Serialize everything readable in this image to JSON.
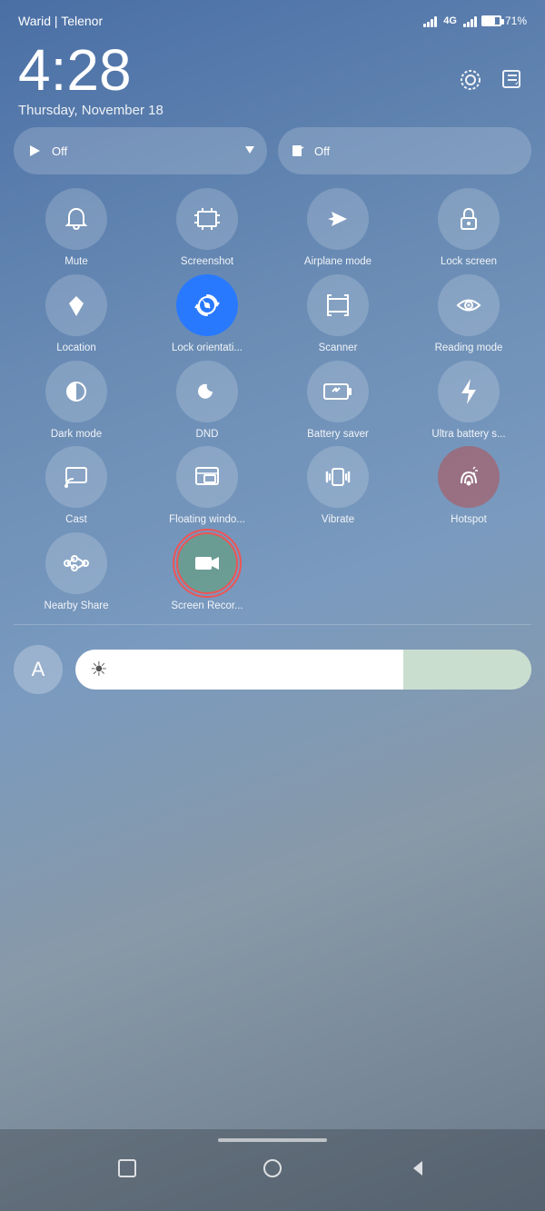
{
  "statusBar": {
    "carrier": "Warid | Telenor",
    "networkType": "4G",
    "batteryPercent": "71%"
  },
  "clock": {
    "time": "4:28",
    "date": "Thursday, November 18"
  },
  "quickPills": [
    {
      "id": "pill-left",
      "icon": "▶",
      "label": "Off"
    },
    {
      "id": "pill-right",
      "icon": "🎵",
      "label": "Off"
    }
  ],
  "quickItems": [
    {
      "id": "mute",
      "label": "Mute",
      "icon": "bell",
      "active": false
    },
    {
      "id": "screenshot",
      "label": "Screenshot",
      "icon": "screenshot",
      "active": false
    },
    {
      "id": "airplane",
      "label": "Airplane mode",
      "icon": "airplane",
      "active": false
    },
    {
      "id": "lockscreen",
      "label": "Lock screen",
      "icon": "lock",
      "active": false
    },
    {
      "id": "location",
      "label": "Location",
      "icon": "location",
      "active": false
    },
    {
      "id": "lock-orientation",
      "label": "Lock orientati...",
      "icon": "rotate",
      "active": true
    },
    {
      "id": "scanner",
      "label": "Scanner",
      "icon": "scanner",
      "active": false
    },
    {
      "id": "reading-mode",
      "label": "Reading mode",
      "icon": "eye",
      "active": false
    },
    {
      "id": "dark-mode",
      "label": "Dark mode",
      "icon": "darkmode",
      "active": false
    },
    {
      "id": "dnd",
      "label": "DND",
      "icon": "moon",
      "active": false
    },
    {
      "id": "battery-saver",
      "label": "Battery saver",
      "icon": "battery-saver",
      "active": false
    },
    {
      "id": "ultra-battery",
      "label": "Ultra battery s...",
      "icon": "lightning",
      "active": false
    },
    {
      "id": "cast",
      "label": "Cast",
      "icon": "cast",
      "active": false
    },
    {
      "id": "floating-window",
      "label": "Floating windo...",
      "icon": "floating",
      "active": false
    },
    {
      "id": "vibrate",
      "label": "Vibrate",
      "icon": "vibrate",
      "active": false
    },
    {
      "id": "hotspot",
      "label": "Hotspot",
      "icon": "hotspot",
      "active": false,
      "special": "red"
    },
    {
      "id": "nearby-share",
      "label": "Nearby Share",
      "icon": "nearby",
      "active": false
    },
    {
      "id": "screen-record",
      "label": "Screen Recor...",
      "icon": "video",
      "active": false,
      "special": "selected"
    }
  ],
  "bottomControls": {
    "avatarLabel": "A",
    "brightnessLabel": "brightness"
  },
  "nav": {
    "homeBarColor": "rgba(255,255,255,0.6)"
  }
}
